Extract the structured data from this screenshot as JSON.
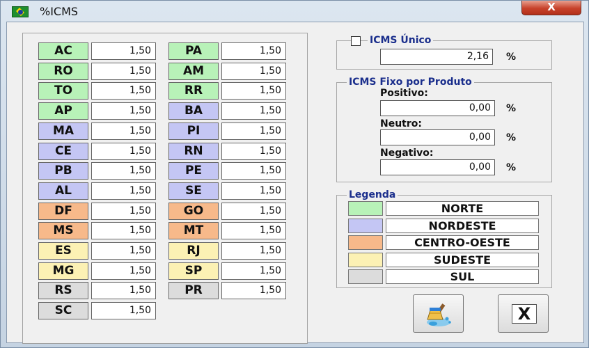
{
  "window": {
    "title": "%ICMS",
    "close_label": "X"
  },
  "colors": {
    "norte": "#b8f2b8",
    "nordeste": "#c4c6f4",
    "centro_oeste": "#f7b98a",
    "sudeste": "#fcf1b4",
    "sul": "#dcdcdc"
  },
  "states": [
    {
      "uf": "AC",
      "value": "1,50",
      "region": "norte"
    },
    {
      "uf": "RO",
      "value": "1,50",
      "region": "norte"
    },
    {
      "uf": "TO",
      "value": "1,50",
      "region": "norte"
    },
    {
      "uf": "AP",
      "value": "1,50",
      "region": "norte"
    },
    {
      "uf": "MA",
      "value": "1,50",
      "region": "nordeste"
    },
    {
      "uf": "CE",
      "value": "1,50",
      "region": "nordeste"
    },
    {
      "uf": "PB",
      "value": "1,50",
      "region": "nordeste"
    },
    {
      "uf": "AL",
      "value": "1,50",
      "region": "nordeste"
    },
    {
      "uf": "DF",
      "value": "1,50",
      "region": "centro_oeste"
    },
    {
      "uf": "MS",
      "value": "1,50",
      "region": "centro_oeste"
    },
    {
      "uf": "ES",
      "value": "1,50",
      "region": "sudeste"
    },
    {
      "uf": "MG",
      "value": "1,50",
      "region": "sudeste"
    },
    {
      "uf": "RS",
      "value": "1,50",
      "region": "sul"
    },
    {
      "uf": "SC",
      "value": "1,50",
      "region": "sul"
    },
    {
      "uf": "PA",
      "value": "1,50",
      "region": "norte"
    },
    {
      "uf": "AM",
      "value": "1,50",
      "region": "norte"
    },
    {
      "uf": "RR",
      "value": "1,50",
      "region": "norte"
    },
    {
      "uf": "BA",
      "value": "1,50",
      "region": "nordeste"
    },
    {
      "uf": "PI",
      "value": "1,50",
      "region": "nordeste"
    },
    {
      "uf": "RN",
      "value": "1,50",
      "region": "nordeste"
    },
    {
      "uf": "PE",
      "value": "1,50",
      "region": "nordeste"
    },
    {
      "uf": "SE",
      "value": "1,50",
      "region": "nordeste"
    },
    {
      "uf": "GO",
      "value": "1,50",
      "region": "centro_oeste"
    },
    {
      "uf": "MT",
      "value": "1,50",
      "region": "centro_oeste"
    },
    {
      "uf": "RJ",
      "value": "1,50",
      "region": "sudeste"
    },
    {
      "uf": "SP",
      "value": "1,50",
      "region": "sudeste"
    },
    {
      "uf": "PR",
      "value": "1,50",
      "region": "sul"
    }
  ],
  "icms_unico": {
    "label": "ICMS Único",
    "checked": false,
    "value": "2,16",
    "unit": "%"
  },
  "icms_fixo": {
    "label": "ICMS Fixo por Produto",
    "positivo_label": "Positivo:",
    "positivo_value": "0,00",
    "neutro_label": "Neutro:",
    "neutro_value": "0,00",
    "negativo_label": "Negativo:",
    "negativo_value": "0,00",
    "unit": "%"
  },
  "legenda": {
    "label": "Legenda",
    "items": [
      {
        "name": "NORTE",
        "region": "norte"
      },
      {
        "name": "NORDESTE",
        "region": "nordeste"
      },
      {
        "name": "CENTRO-OESTE",
        "region": "centro_oeste"
      },
      {
        "name": "SUDESTE",
        "region": "sudeste"
      },
      {
        "name": "SUL",
        "region": "sul"
      }
    ]
  },
  "actions": {
    "clear_icon": "broom-clean-icon",
    "close_label": "X"
  }
}
